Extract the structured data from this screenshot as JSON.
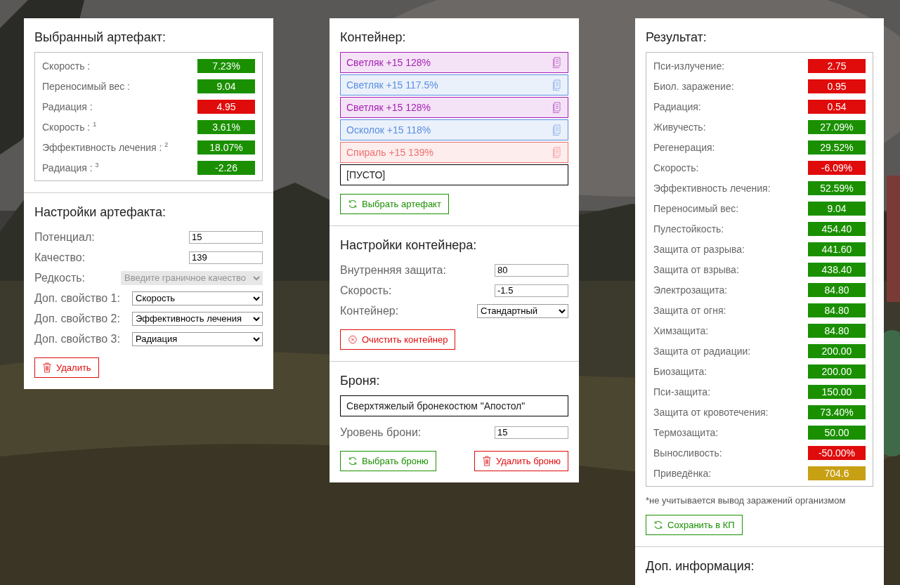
{
  "artifact": {
    "title": "Выбранный артефакт:",
    "stats": [
      {
        "label": "Скорость :",
        "value": "7.23%",
        "color": "#1a9000"
      },
      {
        "label": "Переносимый вес :",
        "value": "9.04",
        "color": "#1a9000"
      },
      {
        "label": "Радиация :",
        "value": "4.95",
        "color": "#e00b0b"
      },
      {
        "label": "Скорость : $^{1}$",
        "value": "3.61%",
        "color": "#1a9000"
      },
      {
        "label": "Эффективность лечения : $^{2}$",
        "value": "18.07%",
        "color": "#1a9000"
      },
      {
        "label": "Радиация : $^{3}$",
        "value": "-2.26",
        "color": "#1a9000"
      }
    ]
  },
  "artifact_settings": {
    "title": "Настройки артефакта:",
    "fields": [
      {
        "kind": "input",
        "label": "Потенциал:",
        "value": "15",
        "disabled": false
      },
      {
        "kind": "input",
        "label": "Качество:",
        "value": "139",
        "disabled": false
      },
      {
        "kind": "select",
        "label": "Редкость:",
        "value": "Введите граничное качество",
        "disabled": true
      },
      {
        "kind": "select",
        "label": "Доп. свойство 1:",
        "value": "Скорость",
        "disabled": false
      },
      {
        "kind": "select",
        "label": "Доп. свойство 2:",
        "value": "Эффективность лечения",
        "disabled": false
      },
      {
        "kind": "select",
        "label": "Доп. свойство 3:",
        "value": "Радиация",
        "disabled": false
      }
    ],
    "buttons": [
      {
        "kind": "delete",
        "label": "Удалить"
      }
    ]
  },
  "container": {
    "title": "Контейнер:",
    "slots": [
      {
        "kind": "artifact",
        "text": "Светляк +15 128%",
        "color": "#a51fb5"
      },
      {
        "kind": "artifact",
        "text": "Светляк +15 117.5%",
        "color": "#5a8ee0"
      },
      {
        "kind": "artifact",
        "text": "Светляк +15 128%",
        "color": "#a51fb5"
      },
      {
        "kind": "artifact",
        "text": "Осколок +15 118%",
        "color": "#5a8ee0"
      },
      {
        "kind": "artifact",
        "text": "Спираль +15 139%",
        "color": "#f07070"
      },
      {
        "kind": "empty",
        "text": "[ПУСТО]"
      }
    ],
    "buttons": [
      {
        "kind": "select",
        "label": "Выбрать артефакт"
      }
    ]
  },
  "container_settings": {
    "title": "Настройки контейнера:",
    "fields": [
      {
        "kind": "input",
        "label": "Внутренняя защита:",
        "value": "80",
        "disabled": false
      },
      {
        "kind": "input",
        "label": "Скорость:",
        "value": "-1.5",
        "disabled": false
      },
      {
        "kind": "select",
        "label": "Контейнер:",
        "value": "Стандартный",
        "disabled": false
      }
    ],
    "buttons": [
      {
        "kind": "clear",
        "label": "Очистить контейнер"
      }
    ]
  },
  "armor": {
    "title": "Броня:",
    "name": "Сверхтяжелый бронекостюм \"Апостол\"",
    "fields": [
      {
        "kind": "input",
        "label": "Уровень брони:",
        "value": "15",
        "disabled": false
      }
    ],
    "buttons": [
      {
        "kind": "select",
        "label": "Выбрать броню"
      },
      {
        "kind": "delete",
        "label": "Удалить броню"
      }
    ]
  },
  "result": {
    "title": "Результат:",
    "stats": [
      {
        "label": "Пси-излучение:",
        "value": "2.75",
        "color": "#e00b0b"
      },
      {
        "label": "Биол. заражение:",
        "value": "0.95",
        "color": "#e00b0b"
      },
      {
        "label": "Радиация:",
        "value": "0.54",
        "color": "#e00b0b"
      },
      {
        "label": "Живучесть:",
        "value": "27.09%",
        "color": "#1a9000"
      },
      {
        "label": "Регенерация:",
        "value": "29.52%",
        "color": "#1a9000"
      },
      {
        "label": "Скорость:",
        "value": "-6.09%",
        "color": "#e00b0b"
      },
      {
        "label": "Эффективность лечения:",
        "value": "52.59%",
        "color": "#1a9000"
      },
      {
        "label": "Переносимый вес:",
        "value": "9.04",
        "color": "#1a9000"
      },
      {
        "label": "Пулестойкость:",
        "value": "454.40",
        "color": "#1a9000"
      },
      {
        "label": "Защита от разрыва:",
        "value": "441.60",
        "color": "#1a9000"
      },
      {
        "label": "Защита от взрыва:",
        "value": "438.40",
        "color": "#1a9000"
      },
      {
        "label": "Электрозащита:",
        "value": "84.80",
        "color": "#1a9000"
      },
      {
        "label": "Защита от огня:",
        "value": "84.80",
        "color": "#1a9000"
      },
      {
        "label": "Химзащита:",
        "value": "84.80",
        "color": "#1a9000"
      },
      {
        "label": "Защита от радиации:",
        "value": "200.00",
        "color": "#1a9000"
      },
      {
        "label": "Биозащита:",
        "value": "200.00",
        "color": "#1a9000"
      },
      {
        "label": "Пси-защита:",
        "value": "150.00",
        "color": "#1a9000"
      },
      {
        "label": "Защита от кровотечения:",
        "value": "73.40%",
        "color": "#1a9000"
      },
      {
        "label": "Термозащита:",
        "value": "50.00",
        "color": "#1a9000"
      },
      {
        "label": "Выносливость:",
        "value": "-50.00%",
        "color": "#e00b0b"
      },
      {
        "label": "Приведёнка:",
        "value": "704.6",
        "color": "#c8a014"
      }
    ],
    "note": "*не учитывается вывод заражений организмом",
    "buttons": [
      {
        "kind": "select",
        "label": "Сохранить в КП"
      }
    ]
  },
  "extra": {
    "title": "Доп. информация:"
  }
}
